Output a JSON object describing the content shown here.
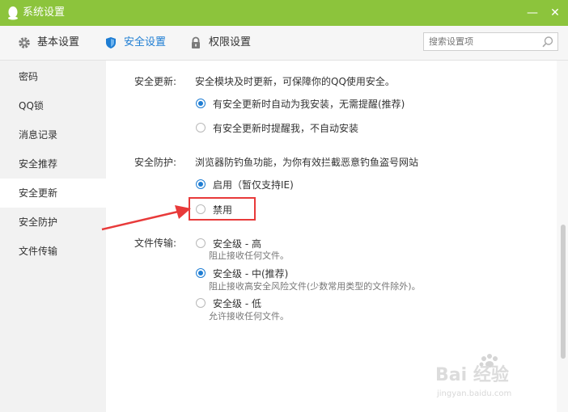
{
  "window": {
    "title": "系统设置",
    "minimize_glyph": "—",
    "close_glyph": "✕",
    "logo_icon": "qq-penguin-icon"
  },
  "toolbar": {
    "tabs": [
      {
        "label": "基本设置",
        "icon": "gear-icon"
      },
      {
        "label": "安全设置",
        "icon": "shield-icon",
        "active": true
      },
      {
        "label": "权限设置",
        "icon": "lock-icon"
      }
    ],
    "search": {
      "placeholder": "搜索设置项",
      "icon": "search-icon"
    }
  },
  "sidebar": {
    "items": [
      {
        "label": "密码"
      },
      {
        "label": "QQ锁"
      },
      {
        "label": "消息记录"
      },
      {
        "label": "安全推荐"
      },
      {
        "label": "安全更新",
        "selected": true
      },
      {
        "label": "安全防护"
      },
      {
        "label": "文件传输"
      }
    ]
  },
  "sections": {
    "update": {
      "label": "安全更新:",
      "desc": "安全模块及时更新，可保障你的QQ使用安全。",
      "options": [
        {
          "label": "有安全更新时自动为我安装，无需提醒(推荐)",
          "checked": true
        },
        {
          "label": "有安全更新时提醒我，不自动安装",
          "checked": false
        }
      ]
    },
    "protect": {
      "label": "安全防护:",
      "desc": "浏览器防钓鱼功能，为你有效拦截恶意钓鱼盗号网站",
      "options": [
        {
          "label": "启用（暂仅支持IE)",
          "checked": true
        },
        {
          "label": "禁用",
          "checked": false
        }
      ]
    },
    "file": {
      "label": "文件传输:",
      "options": [
        {
          "label": "安全级 - 高",
          "sub": "阻止接收任何文件。",
          "checked": false
        },
        {
          "label": "安全级 - 中(推荐)",
          "sub": "阻止接收高安全风险文件(少数常用类型的文件除外)。",
          "checked": true
        },
        {
          "label": "安全级 - 低",
          "sub": "允许接收任何文件。",
          "checked": false
        }
      ]
    }
  },
  "annotation": {
    "highlight_color": "#e83a3a"
  },
  "watermark": {
    "brand": "Bai 经验",
    "url": "jingyan.baidu.com"
  },
  "colors": {
    "titlebar": "#8cc43c",
    "accent": "#1e7dd3"
  }
}
